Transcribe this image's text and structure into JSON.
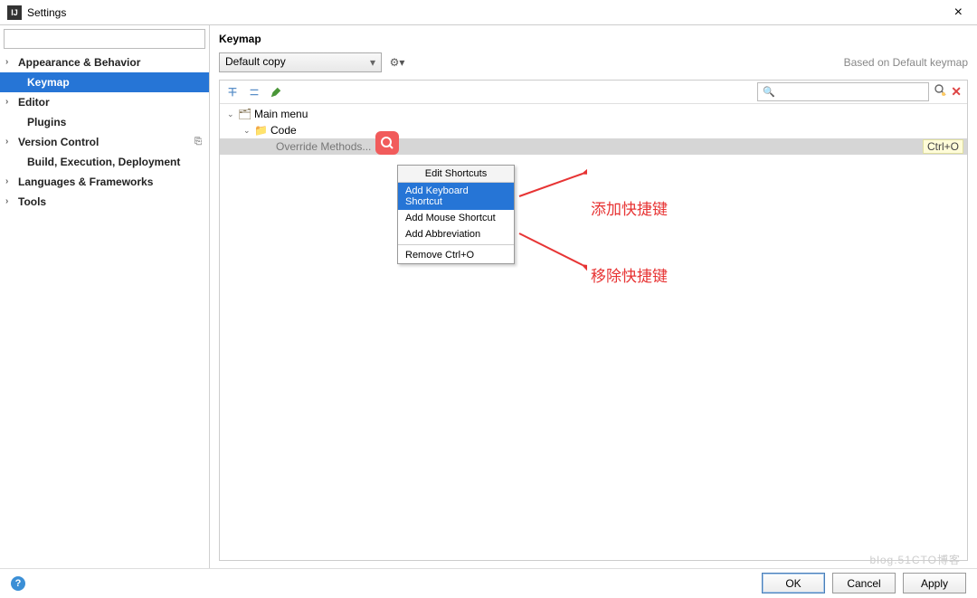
{
  "title": "Settings",
  "sidebar": {
    "items": [
      {
        "label": "Appearance & Behavior",
        "expandable": true
      },
      {
        "label": "Keymap",
        "expandable": false,
        "selected": true,
        "child": true
      },
      {
        "label": "Editor",
        "expandable": true
      },
      {
        "label": "Plugins",
        "expandable": false,
        "child": true
      },
      {
        "label": "Version Control",
        "expandable": true,
        "badge": "⎘"
      },
      {
        "label": "Build, Execution, Deployment",
        "expandable": false,
        "child": true
      },
      {
        "label": "Languages & Frameworks",
        "expandable": true
      },
      {
        "label": "Tools",
        "expandable": true
      }
    ]
  },
  "content": {
    "title": "Keymap",
    "keymap_select": "Default copy",
    "based_on": "Based on Default keymap",
    "tree": {
      "root_label": "Main menu",
      "folder_label": "Code",
      "selected_item": "Override Methods...",
      "shortcut": "Ctrl+O"
    },
    "context_menu": {
      "header": "Edit Shortcuts",
      "items": [
        "Add Keyboard Shortcut",
        "Add Mouse Shortcut",
        "Add Abbreviation"
      ],
      "remove": "Remove Ctrl+O"
    }
  },
  "annotations": {
    "add": "添加快捷键",
    "remove": "移除快捷键"
  },
  "footer": {
    "ok": "OK",
    "cancel": "Cancel",
    "apply": "Apply"
  },
  "watermark": "blog.51CTO博客"
}
